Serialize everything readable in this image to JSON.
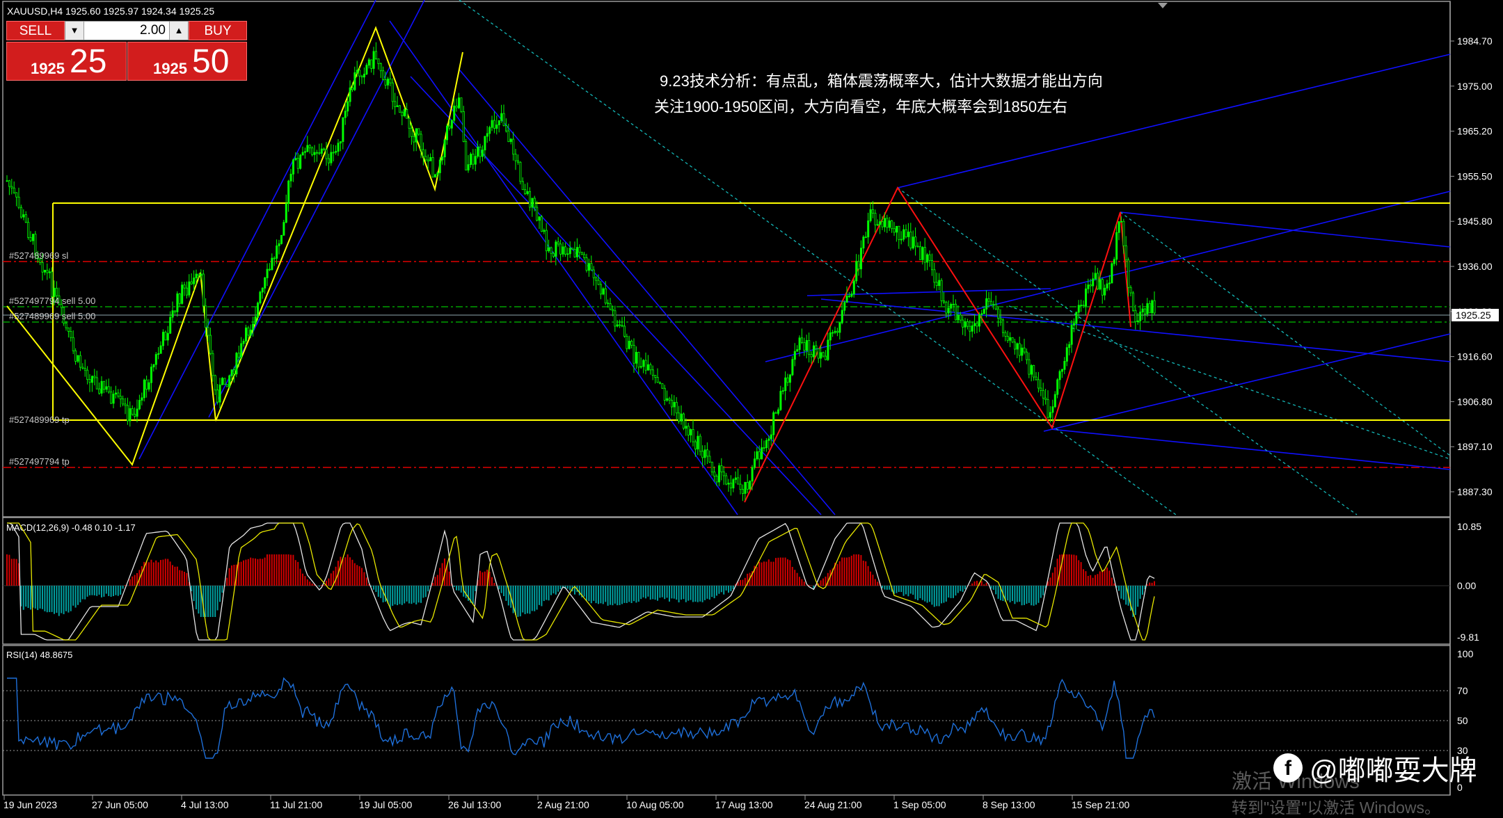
{
  "window": {
    "symbol_header": "XAUUSD,H4  1925.60 1925.97 1924.34 1925.25"
  },
  "trade_panel": {
    "sell_label": "SELL",
    "buy_label": "BUY",
    "lot_value": "2.00",
    "down_arrow": "▼",
    "up_arrow": "▲",
    "sell_price_small": "1925",
    "sell_price_big": "25",
    "buy_price_small": "1925",
    "buy_price_big": "50"
  },
  "annotation": {
    "line1": "9.23技术分析：有点乱，箱体震荡概率大，估计大数据才能出方向",
    "line2": "关注1900-1950区间，大方向看空，年底大概率会到1850左右"
  },
  "order_labels": {
    "sl_1": "#527489969 sl",
    "sell_1": "#527497794 sell 5.00",
    "sell_2": "#527489969 sell 5.00",
    "tp_1": "#527489969 tp",
    "tp_2": "#527497794 tp"
  },
  "price_axis": {
    "ticks": [
      "1984.70",
      "1975.00",
      "1965.20",
      "1955.50",
      "1945.80",
      "1936.00",
      "1926.30",
      "1916.60",
      "1906.80",
      "1897.10",
      "1887.30"
    ],
    "current_price": "1925.25"
  },
  "macd": {
    "label": "MACD(12,26,9) -0.48 0.10 -1.17",
    "ticks": [
      "10.85",
      "0.00",
      "-9.81"
    ]
  },
  "rsi": {
    "label": "RSI(14) 48.8675",
    "ticks": [
      "100",
      "70",
      "50",
      "30",
      "0"
    ]
  },
  "time_axis": {
    "labels": [
      "19 Jun 2023",
      "27 Jun 05:00",
      "4 Jul 13:00",
      "11 Jul 21:00",
      "19 Jul 05:00",
      "26 Jul 13:00",
      "2 Aug 21:00",
      "10 Aug 05:00",
      "17 Aug 13:00",
      "24 Aug 21:00",
      "1 Sep 05:00",
      "8 Sep 13:00",
      "15 Sep 21:00"
    ]
  },
  "watermark": {
    "line1": "激活 Windows",
    "line2": "转到\"设置\"以激活 Windows。"
  },
  "social": {
    "logo": "f",
    "handle": "@嘟嘟耍大牌"
  },
  "colors": {
    "background": "#000000",
    "up_candle": "#00ff00",
    "box_lines": "#ffff00",
    "zigzag_red": "#ff0000",
    "channels": "#0000ff",
    "dashed_channel": "#00c0c0",
    "sl_tp": "#ff0000",
    "macd_pos": "#d40000",
    "macd_neg": "#00a0a0",
    "rsi_line": "#1e6fd9",
    "panel_red": "#d21d1d"
  }
}
